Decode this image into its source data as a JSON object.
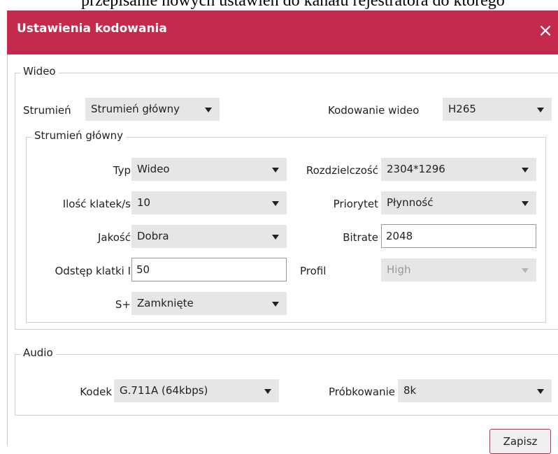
{
  "background_text": "przepisanie nowych ustawień do kanału rejestratora do którego",
  "dialog": {
    "title": "Ustawienia kodowania",
    "close_glyph": "×"
  },
  "video": {
    "legend": "Wideo",
    "stream_label": "Strumień",
    "stream_value": "Strumień główny",
    "encoding_label": "Kodowanie wideo",
    "encoding_value": "H265",
    "main_stream": {
      "legend": "Strumień główny",
      "type_label": "Typ",
      "type_value": "Wideo",
      "resolution_label": "Rozdzielczość",
      "resolution_value": "2304*1296",
      "fps_label": "Ilość klatek/s",
      "fps_value": "10",
      "priority_label": "Priorytet",
      "priority_value": "Płynność",
      "quality_label": "Jakość",
      "quality_value": "Dobra",
      "bitrate_label": "Bitrate",
      "bitrate_value": "2048",
      "iframe_label": "Odstęp klatki I",
      "iframe_value": "50",
      "profile_label": "Profil",
      "profile_value": "High",
      "splus_label": "S+",
      "splus_value": "Zamknięte"
    }
  },
  "audio": {
    "legend": "Audio",
    "codec_label": "Kodek",
    "codec_value": "G.711A (64kbps)",
    "sampling_label": "Próbkowanie",
    "sampling_value": "8k"
  },
  "buttons": {
    "save_label": "Zapisz"
  },
  "colors": {
    "titlebar": "#c42a4c",
    "select_bg": "#e6e6e6",
    "save_border": "#c42a4c"
  },
  "icons": {
    "close": "close-icon",
    "dropdown": "chevron-down-icon"
  }
}
